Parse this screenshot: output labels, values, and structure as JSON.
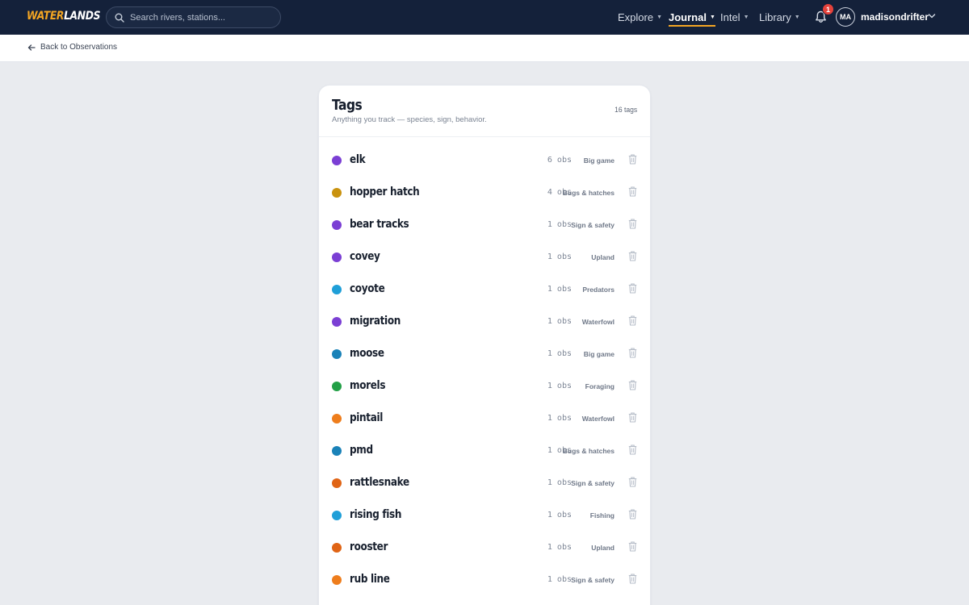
{
  "brand": {
    "part1": "WATER",
    "part2": "LANDS"
  },
  "search": {
    "placeholder": "Search rivers, stations..."
  },
  "nav": {
    "items": [
      {
        "label": "Explore"
      },
      {
        "label": "Journal"
      },
      {
        "label": "Intel"
      },
      {
        "label": "Library"
      }
    ],
    "notifications": "1",
    "avatar_initials": "MA",
    "username": "madisondrifter"
  },
  "subbar": {
    "back_label": "Back to Observations"
  },
  "card": {
    "title": "Tags",
    "subtitle": "Anything you track — species, sign, behavior.",
    "count": "16 tags"
  },
  "tags": [
    {
      "name": "elk",
      "obs": "6 obs",
      "category": "Big game",
      "color": "#7b3fd4"
    },
    {
      "name": "hopper hatch",
      "obs": "4 obs",
      "category": "Bugs & hatches",
      "color": "#c9920e"
    },
    {
      "name": "bear tracks",
      "obs": "1 obs",
      "category": "Sign & safety",
      "color": "#7b3fd4"
    },
    {
      "name": "covey",
      "obs": "1 obs",
      "category": "Upland",
      "color": "#7b3fd4"
    },
    {
      "name": "coyote",
      "obs": "1 obs",
      "category": "Predators",
      "color": "#1f9fd8"
    },
    {
      "name": "migration",
      "obs": "1 obs",
      "category": "Waterfowl",
      "color": "#7b3fd4"
    },
    {
      "name": "moose",
      "obs": "1 obs",
      "category": "Big game",
      "color": "#1a82b8"
    },
    {
      "name": "morels",
      "obs": "1 obs",
      "category": "Foraging",
      "color": "#23a047"
    },
    {
      "name": "pintail",
      "obs": "1 obs",
      "category": "Waterfowl",
      "color": "#ee7d1c"
    },
    {
      "name": "pmd",
      "obs": "1 obs",
      "category": "Bugs & hatches",
      "color": "#1a82b8"
    },
    {
      "name": "rattlesnake",
      "obs": "1 obs",
      "category": "Sign & safety",
      "color": "#e06415"
    },
    {
      "name": "rising fish",
      "obs": "1 obs",
      "category": "Fishing",
      "color": "#1f9fd8"
    },
    {
      "name": "rooster",
      "obs": "1 obs",
      "category": "Upland",
      "color": "#e06415"
    },
    {
      "name": "rub line",
      "obs": "1 obs",
      "category": "Sign & safety",
      "color": "#ee7d1c"
    }
  ]
}
